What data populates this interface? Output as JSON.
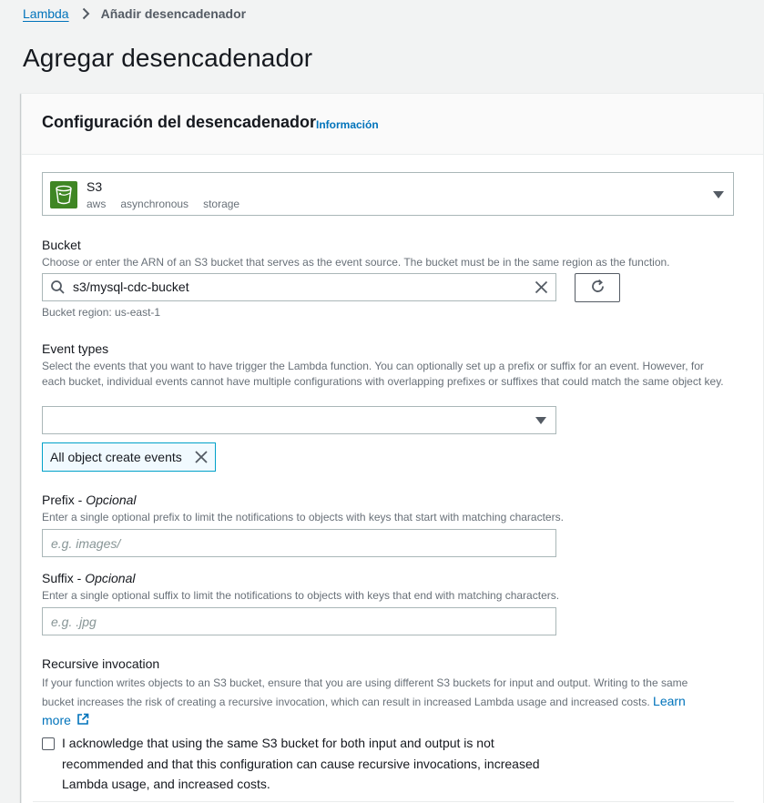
{
  "breadcrumb": {
    "root": "Lambda",
    "current": "Añadir desencadenador"
  },
  "page_title": "Agregar desencadenador",
  "panel": {
    "title": "Configuración del desencadenador",
    "info": "Información"
  },
  "trigger": {
    "name": "S3",
    "tags": [
      "aws",
      "asynchronous",
      "storage"
    ],
    "icon": "s3-bucket-icon"
  },
  "bucket": {
    "label": "Bucket",
    "description": "Choose or enter the ARN of an S3 bucket that serves as the event source. The bucket must be in the same region as the function.",
    "value": "s3/mysql-cdc-bucket",
    "region": "Bucket region: us-east-1"
  },
  "event_types": {
    "label": "Event types",
    "description": "Select the events that you want to have trigger the Lambda function. You can optionally set up a prefix or suffix for an event. However, for each bucket, individual events cannot have multiple configurations with overlapping prefixes or suffixes that could match the same object key.",
    "select_value": "",
    "tokens": [
      "All object create events"
    ]
  },
  "prefix": {
    "label": "Prefix",
    "optional": "Opcional",
    "description": "Enter a single optional prefix to limit the notifications to objects with keys that start with matching characters.",
    "placeholder": "e.g. images/"
  },
  "suffix": {
    "label": "Suffix",
    "optional": "Opcional",
    "description": "Enter a single optional suffix to limit the notifications to objects with keys that end with matching characters.",
    "placeholder": "e.g. .jpg"
  },
  "recursive": {
    "label": "Recursive invocation",
    "description": "If your function writes objects to an S3 bucket, ensure that you are using different S3 buckets for input and output. Writing to the same bucket increases the risk of creating a recursive invocation, which can result in increased Lambda usage and increased costs.",
    "learn_more": "Learn more",
    "acknowledge": "I acknowledge that using the same S3 bucket for both input and output is not recommended and that this configuration can cause recursive invocations, increased Lambda usage, and increased costs.",
    "acknowledged": false
  },
  "colors": {
    "link": "#0073bb",
    "s3_green": "#3f8624",
    "token_border": "#00a1c9",
    "token_bg": "#f1faff"
  }
}
